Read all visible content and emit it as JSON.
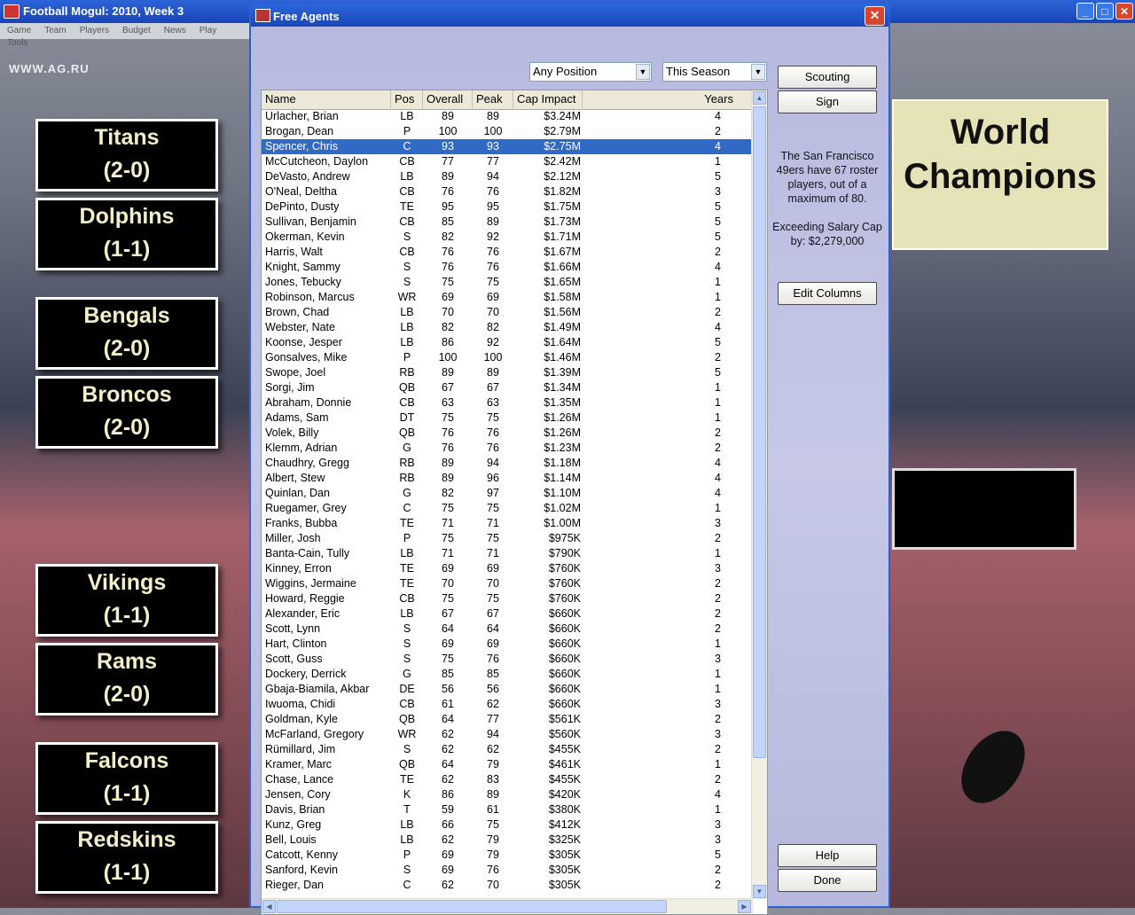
{
  "window": {
    "title": "Football Mogul: 2010, Week 3",
    "menu": [
      "Game",
      "Team",
      "Players",
      "Budget",
      "News",
      "Play",
      "Tools"
    ],
    "watermark": "WWW.AG.RU",
    "controls": {
      "minimize": "_",
      "maximize": "□",
      "close": "✕"
    }
  },
  "standings": [
    {
      "team": "Titans",
      "record": "(2-0)"
    },
    {
      "team": "Dolphins",
      "record": "(1-1)"
    },
    {
      "team": "Bengals",
      "record": "(2-0)"
    },
    {
      "team": "Broncos",
      "record": "(2-0)"
    },
    {
      "team": "Vikings",
      "record": "(1-1)"
    },
    {
      "team": "Rams",
      "record": "(2-0)"
    },
    {
      "team": "Falcons",
      "record": "(1-1)"
    },
    {
      "team": "Redskins",
      "record": "(1-1)"
    }
  ],
  "banner": {
    "line1": "World",
    "line2": "Champions"
  },
  "dialog": {
    "title": "Free Agents",
    "close": "✕",
    "position_filter": "Any Position",
    "season_filter": "This Season",
    "buttons": {
      "scouting": "Scouting",
      "sign": "Sign",
      "edit_columns": "Edit Columns",
      "help": "Help",
      "done": "Done"
    },
    "roster_info": "The San Francisco 49ers have 67 roster players, out of a maximum of 80.",
    "salary_info": "Exceeding Salary Cap by: $2,279,000",
    "columns": {
      "name": "Name",
      "pos": "Pos",
      "overall": "Overall",
      "peak": "Peak",
      "cap": "Cap Impact",
      "years": "Years"
    },
    "selected_index": 2,
    "players": [
      [
        "Urlacher, Brian",
        "LB",
        "89",
        "89",
        "$3.24M",
        "4"
      ],
      [
        "Brogan, Dean",
        "P",
        "100",
        "100",
        "$2.79M",
        "2"
      ],
      [
        "Spencer, Chris",
        "C",
        "93",
        "93",
        "$2.75M",
        "4"
      ],
      [
        "McCutcheon, Daylon",
        "CB",
        "77",
        "77",
        "$2.42M",
        "1"
      ],
      [
        "DeVasto, Andrew",
        "LB",
        "89",
        "94",
        "$2.12M",
        "5"
      ],
      [
        "O'Neal, Deltha",
        "CB",
        "76",
        "76",
        "$1.82M",
        "3"
      ],
      [
        "DePinto, Dusty",
        "TE",
        "95",
        "95",
        "$1.75M",
        "5"
      ],
      [
        "Sullivan, Benjamin",
        "CB",
        "85",
        "89",
        "$1.73M",
        "5"
      ],
      [
        "Okerman, Kevin",
        "S",
        "82",
        "92",
        "$1.71M",
        "5"
      ],
      [
        "Harris, Walt",
        "CB",
        "76",
        "76",
        "$1.67M",
        "2"
      ],
      [
        "Knight, Sammy",
        "S",
        "76",
        "76",
        "$1.66M",
        "4"
      ],
      [
        "Jones, Tebucky",
        "S",
        "75",
        "75",
        "$1.65M",
        "1"
      ],
      [
        "Robinson, Marcus",
        "WR",
        "69",
        "69",
        "$1.58M",
        "1"
      ],
      [
        "Brown, Chad",
        "LB",
        "70",
        "70",
        "$1.56M",
        "2"
      ],
      [
        "Webster, Nate",
        "LB",
        "82",
        "82",
        "$1.49M",
        "4"
      ],
      [
        "Koonse, Jesper",
        "LB",
        "86",
        "92",
        "$1.64M",
        "5"
      ],
      [
        "Gonsalves, Mike",
        "P",
        "100",
        "100",
        "$1.46M",
        "2"
      ],
      [
        "Swope, Joel",
        "RB",
        "89",
        "89",
        "$1.39M",
        "5"
      ],
      [
        "Sorgi, Jim",
        "QB",
        "67",
        "67",
        "$1.34M",
        "1"
      ],
      [
        "Abraham, Donnie",
        "CB",
        "63",
        "63",
        "$1.35M",
        "1"
      ],
      [
        "Adams, Sam",
        "DT",
        "75",
        "75",
        "$1.26M",
        "1"
      ],
      [
        "Volek, Billy",
        "QB",
        "76",
        "76",
        "$1.26M",
        "2"
      ],
      [
        "Klemm, Adrian",
        "G",
        "76",
        "76",
        "$1.23M",
        "2"
      ],
      [
        "Chaudhry, Gregg",
        "RB",
        "89",
        "94",
        "$1.18M",
        "4"
      ],
      [
        "Albert, Stew",
        "RB",
        "89",
        "96",
        "$1.14M",
        "4"
      ],
      [
        "Quinlan, Dan",
        "G",
        "82",
        "97",
        "$1.10M",
        "4"
      ],
      [
        "Ruegamer, Grey",
        "C",
        "75",
        "75",
        "$1.02M",
        "1"
      ],
      [
        "Franks, Bubba",
        "TE",
        "71",
        "71",
        "$1.00M",
        "3"
      ],
      [
        "Miller, Josh",
        "P",
        "75",
        "75",
        "$975K",
        "2"
      ],
      [
        "Banta-Cain, Tully",
        "LB",
        "71",
        "71",
        "$790K",
        "1"
      ],
      [
        "Kinney, Erron",
        "TE",
        "69",
        "69",
        "$760K",
        "3"
      ],
      [
        "Wiggins, Jermaine",
        "TE",
        "70",
        "70",
        "$760K",
        "2"
      ],
      [
        "Howard, Reggie",
        "CB",
        "75",
        "75",
        "$760K",
        "2"
      ],
      [
        "Alexander, Eric",
        "LB",
        "67",
        "67",
        "$660K",
        "2"
      ],
      [
        "Scott, Lynn",
        "S",
        "64",
        "64",
        "$660K",
        "2"
      ],
      [
        "Hart, Clinton",
        "S",
        "69",
        "69",
        "$660K",
        "1"
      ],
      [
        "Scott, Guss",
        "S",
        "75",
        "76",
        "$660K",
        "3"
      ],
      [
        "Dockery, Derrick",
        "G",
        "85",
        "85",
        "$660K",
        "1"
      ],
      [
        "Gbaja-Biamila, Akbar",
        "DE",
        "56",
        "56",
        "$660K",
        "1"
      ],
      [
        "Iwuoma, Chidi",
        "CB",
        "61",
        "62",
        "$660K",
        "3"
      ],
      [
        "Goldman, Kyle",
        "QB",
        "64",
        "77",
        "$561K",
        "2"
      ],
      [
        "McFarland, Gregory",
        "WR",
        "62",
        "94",
        "$560K",
        "3"
      ],
      [
        "Rümillard, Jim",
        "S",
        "62",
        "62",
        "$455K",
        "2"
      ],
      [
        "Kramer, Marc",
        "QB",
        "64",
        "79",
        "$461K",
        "1"
      ],
      [
        "Chase, Lance",
        "TE",
        "62",
        "83",
        "$455K",
        "2"
      ],
      [
        "Jensen, Cory",
        "K",
        "86",
        "89",
        "$420K",
        "4"
      ],
      [
        "Davis, Brian",
        "T",
        "59",
        "61",
        "$380K",
        "1"
      ],
      [
        "Kunz, Greg",
        "LB",
        "66",
        "75",
        "$412K",
        "3"
      ],
      [
        "Bell, Louis",
        "LB",
        "62",
        "79",
        "$325K",
        "3"
      ],
      [
        "Catcott, Kenny",
        "P",
        "69",
        "79",
        "$305K",
        "5"
      ],
      [
        "Sanford, Kevin",
        "S",
        "69",
        "76",
        "$305K",
        "2"
      ],
      [
        "Rieger, Dan",
        "C",
        "62",
        "70",
        "$305K",
        "2"
      ]
    ]
  }
}
